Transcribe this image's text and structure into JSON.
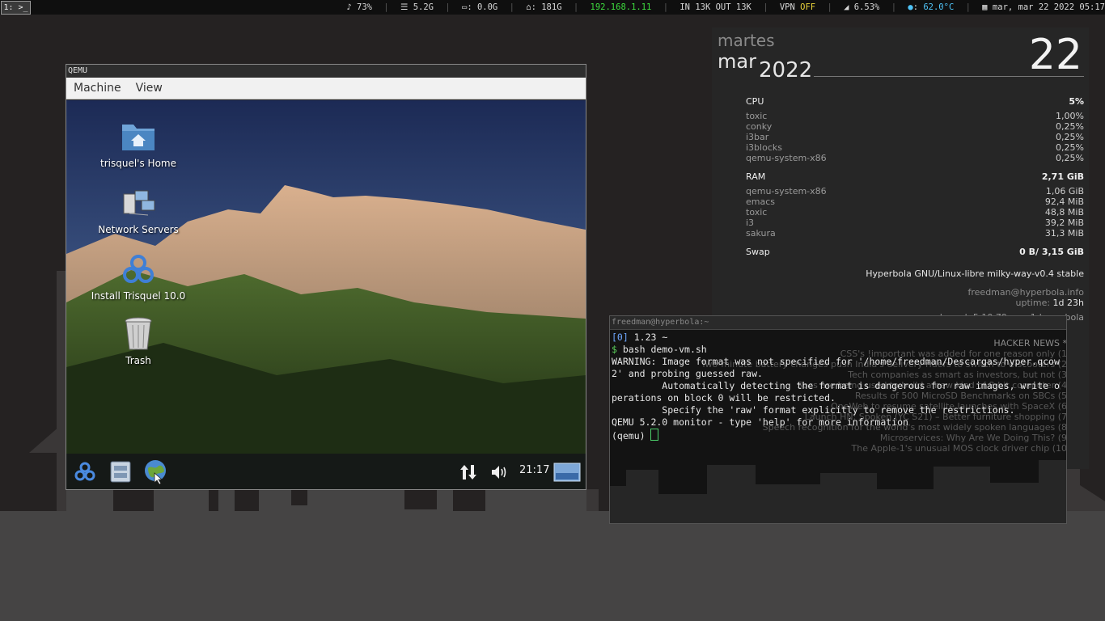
{
  "topbar": {
    "workspace": "1: >_",
    "volume": "♪ 73%",
    "disk_root": "5.2G",
    "disk_a": "0.0G",
    "disk_home": "181G",
    "ip": "192.168.1.11",
    "net": "IN 13K OUT 13K",
    "vpn_label": "VPN",
    "vpn_state": "OFF",
    "cpu": "6.53%",
    "temp": "62.0°C",
    "datetime": "mar, mar 22 2022 05:17"
  },
  "colors": {
    "ip": "#3ddc3d",
    "vpn_off": "#e8d23a",
    "temp": "#4fc3f7"
  },
  "conky": {
    "dayname": "martes",
    "month": "mar",
    "year": "2022",
    "daynum": "22",
    "cpu_label": "CPU",
    "cpu_total": "5%",
    "cpu_procs": [
      {
        "name": "toxic",
        "val": "1,00%"
      },
      {
        "name": "conky",
        "val": "0,25%"
      },
      {
        "name": "i3bar",
        "val": "0,25%"
      },
      {
        "name": "i3blocks",
        "val": "0,25%"
      },
      {
        "name": "qemu-system-x86",
        "val": "0,25%"
      }
    ],
    "ram_label": "RAM",
    "ram_total": "2,71 GiB",
    "ram_procs": [
      {
        "name": "qemu-system-x86",
        "val": "1,06 GiB"
      },
      {
        "name": "emacs",
        "val": "92,4 MiB"
      },
      {
        "name": "toxic",
        "val": "48,8 MiB"
      },
      {
        "name": "i3",
        "val": "39,2 MiB"
      },
      {
        "name": "sakura",
        "val": "31,3 MiB"
      }
    ],
    "swap_label": "Swap",
    "swap_val": "0 B/ 3,15 GiB",
    "os": "Hyperbola GNU/Linux-libre milky-way-v0.4 stable",
    "user": "freedman@hyperbola.info",
    "uptime_label": "uptime:",
    "uptime_val": "1d 23h",
    "kernel_partial": "kernel: 5.10.79-gnu-1-hyperbola",
    "hn_title": "HACKER NEWS *",
    "hn_items": [
      "CSS's !important was added for one reason only (1",
      "Two-minute battery changes push India's delivery riders to switch to e-scooters (2",
      "Tech companies as smart as investors, but not (3",
      "Sbcs are being used to build a new kind of 8-bit computer (4",
      "Results of 500 MicroSD Benchmarks on SBCs (5",
      "OneWeb to resume satellite launches with SpaceX (6",
      "Launch HN: Spoken (YC S21) – Better furniture shopping (7",
      "Speech recognition for the world's most widely spoken languages (8",
      "Microservices: Why Are We Doing This? (9",
      "The Apple-1's unusual MOS clock driver chip (10"
    ]
  },
  "qemu": {
    "title": "QEMU",
    "menu": [
      "Machine",
      "View"
    ],
    "desktop_icons": [
      "trisquel's Home",
      "Network Servers",
      "Install Trisquel 10.0",
      "Trash"
    ],
    "clock": "21:17"
  },
  "terminal": {
    "title": "freedman@hyperbola:~",
    "prompt_count": "[0]",
    "prompt_load": "1.23 ~",
    "prompt_sym": "$",
    "command": "bash demo-vm.sh",
    "output": [
      "WARNING: Image format was not specified for '/home/freedman/Descargas/hyper.qcow",
      "2' and probing guessed raw.",
      "         Automatically detecting the format is dangerous for raw images, write o",
      "perations on block 0 will be restricted.",
      "         Specify the 'raw' format explicitly to remove the restrictions.",
      "QEMU 5.2.0 monitor - type 'help' for more information"
    ],
    "monitor_prompt": "(qemu)"
  }
}
